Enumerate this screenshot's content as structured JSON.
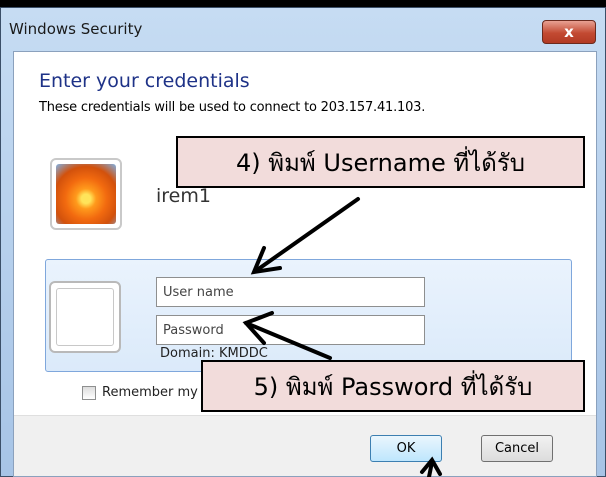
{
  "window": {
    "title": "Windows Security",
    "close_glyph": "x"
  },
  "dialog": {
    "heading": "Enter your credentials",
    "subheading": "These credentials will be used to connect to 203.157.41.103.",
    "existing_account": {
      "name": "irem1"
    },
    "fields": {
      "username_placeholder": "User name",
      "password_placeholder": "Password"
    },
    "domain": "Domain: KMDDC",
    "remember_label": "Remember my credentials",
    "ok_label": "OK",
    "cancel_label": "Cancel"
  },
  "annotations": {
    "callout_username": "4) พิมพ์ Username ที่ได้รับ",
    "callout_password": "5) พิมพ์ Password ที่ได้รับ"
  },
  "colors": {
    "accent_heading": "#1e3287",
    "callout_fill": "#f2dcdb",
    "close_red": "#c34a32"
  }
}
